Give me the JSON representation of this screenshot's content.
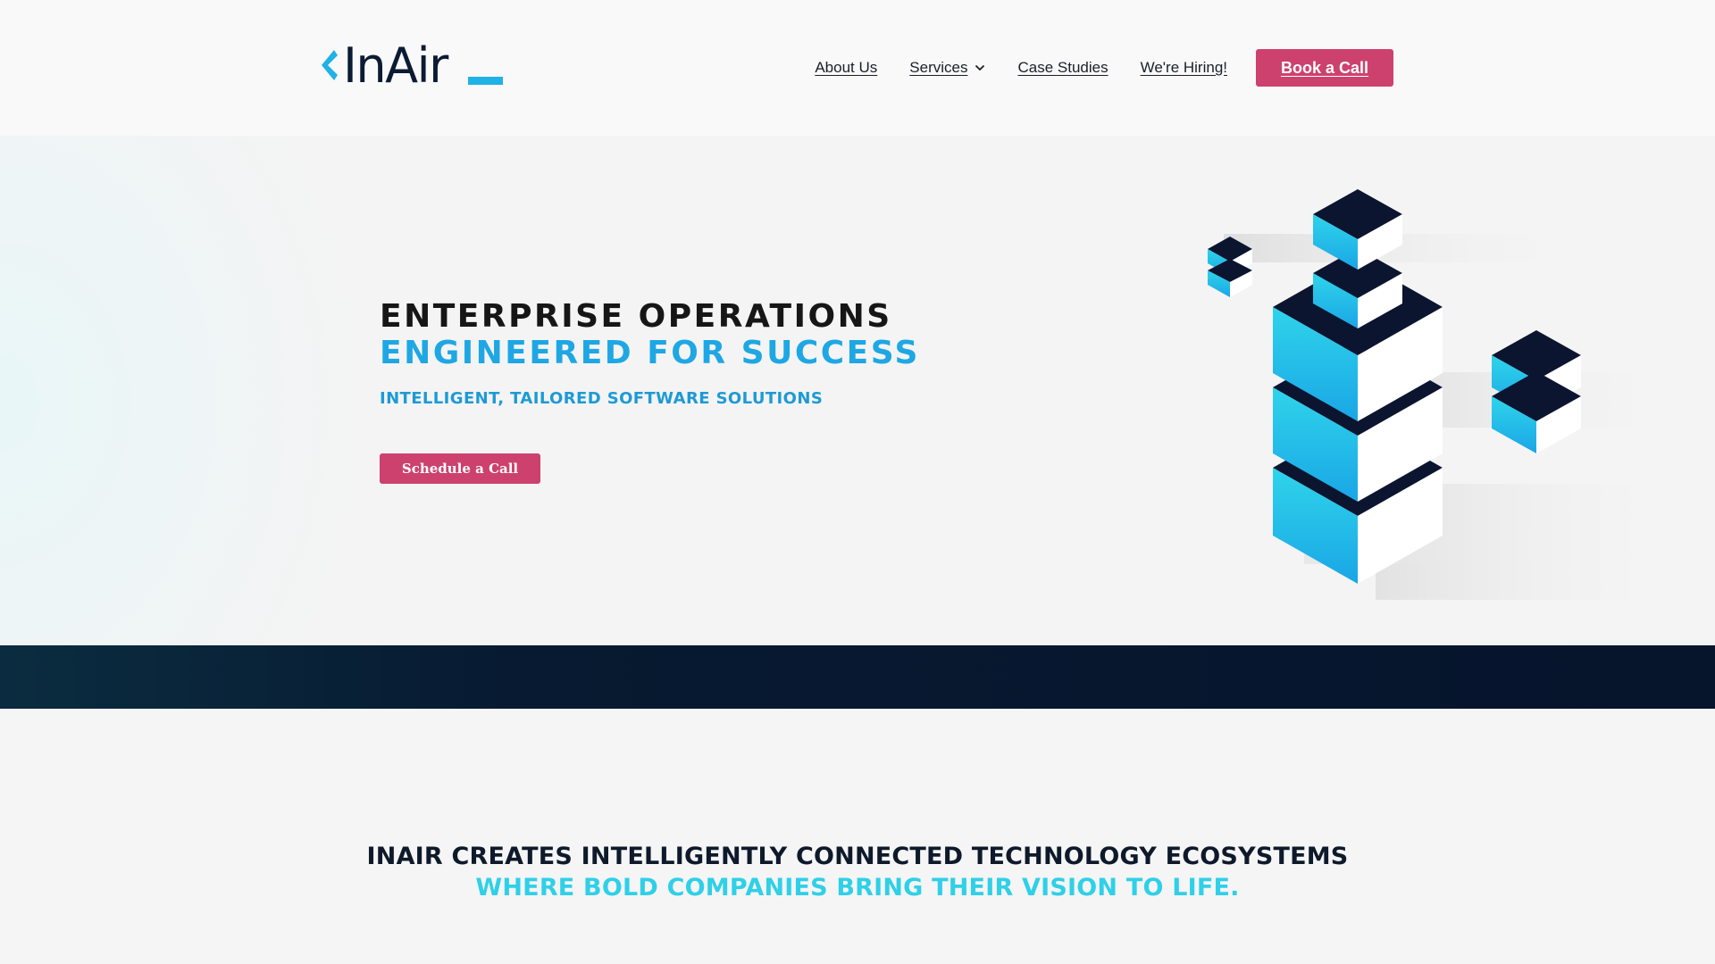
{
  "header": {
    "logo_text": "InAir",
    "nav": {
      "about": "About Us",
      "services": "Services",
      "case_studies": "Case Studies",
      "hiring": "We're Hiring!",
      "book_call": "Book a Call"
    }
  },
  "hero": {
    "title_line1": "ENTERPRISE OPERATIONS",
    "title_line2": "ENGINEERED FOR SUCCESS",
    "subtitle": "INTELLIGENT, TAILORED SOFTWARE SOLUTIONS",
    "cta": "Schedule a Call"
  },
  "statement": {
    "text_main": "INAIR CREATES INTELLIGENTLY CONNECTED TECHNOLOGY ECOSYSTEMS ",
    "text_accent": "WHERE BOLD COMPANIES BRING THEIR VISION TO LIFE."
  },
  "icons": {
    "logo_chevron": "chevron-left-icon",
    "services_dropdown": "chevron-down-icon",
    "hero_art": "isometric-cubes-illustration"
  },
  "colors": {
    "brand_pink": "#cd416f",
    "brand_cyan": "#1ea7e4",
    "accent_cyan": "#2fd0e8",
    "dark_navy": "#0b1b33"
  }
}
